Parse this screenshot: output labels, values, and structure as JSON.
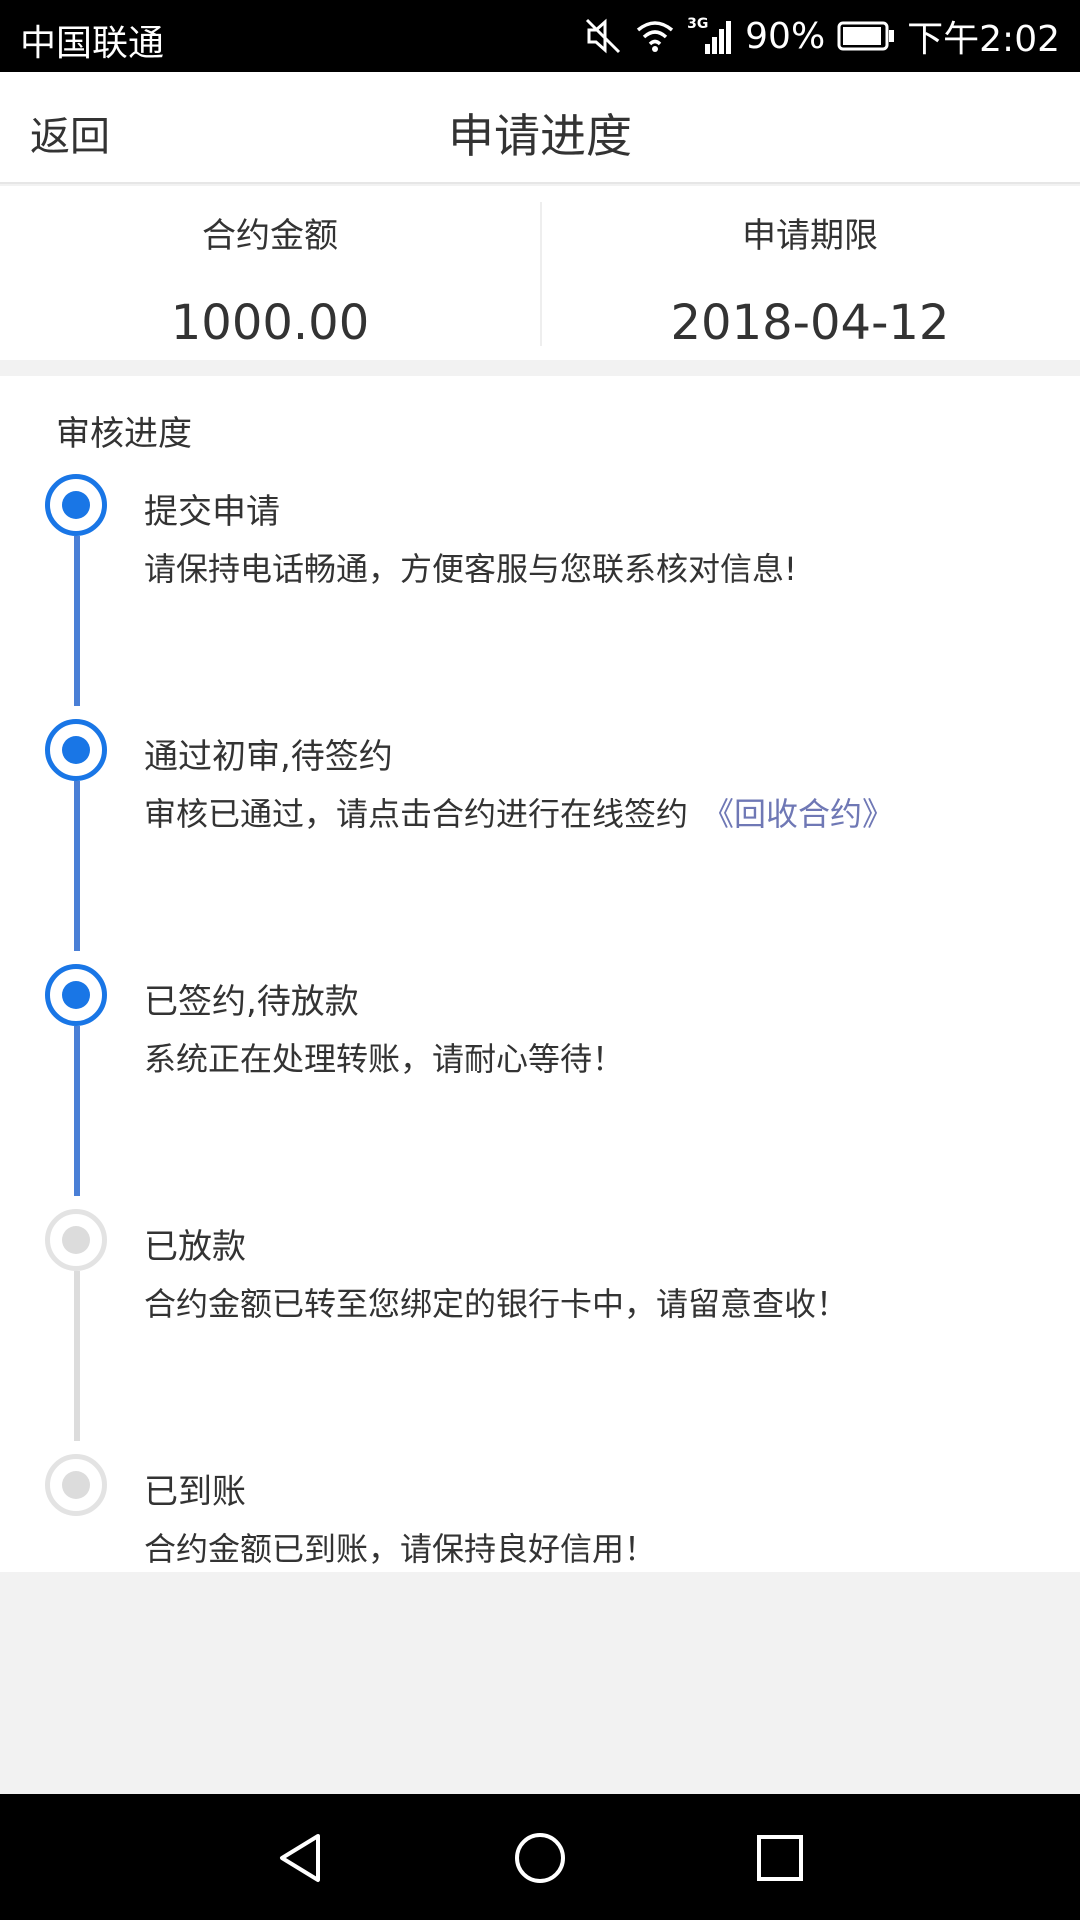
{
  "status_bar": {
    "carrier": "中国联通",
    "battery_percent": "90%",
    "time": "下午2:02",
    "network_type": "3G",
    "icons": [
      "mute-icon",
      "wifi-icon",
      "signal-icon",
      "battery-icon"
    ]
  },
  "nav": {
    "back_label": "返回",
    "title": "申请进度"
  },
  "summary": {
    "amount_label": "合约金额",
    "amount_value": "1000.00",
    "term_label": "申请期限",
    "term_value": "2018-04-12"
  },
  "progress": {
    "section_title": "审核进度",
    "steps": [
      {
        "title": "提交申请",
        "desc": "请保持电话畅通，方便客服与您联系核对信息!",
        "completed": true
      },
      {
        "title": "通过初审,待签约",
        "desc": "审核已通过，请点击合约进行在线签约",
        "link": "《回收合约》",
        "completed": true
      },
      {
        "title": "已签约,待放款",
        "desc": "系统正在处理转账，请耐心等待！",
        "completed": true
      },
      {
        "title": "已放款",
        "desc": "合约金额已转至您绑定的银行卡中，请留意查收！",
        "completed": false
      },
      {
        "title": "已到账",
        "desc": "合约金额已到账，请保持良好信用！",
        "completed": false
      }
    ]
  },
  "colors": {
    "accent": "#1976e6",
    "line_active": "#4a7fd6",
    "inactive": "#dcdcdc",
    "link": "#6f78b5"
  },
  "system_nav": [
    "back-triangle-icon",
    "home-circle-icon",
    "recents-square-icon"
  ]
}
